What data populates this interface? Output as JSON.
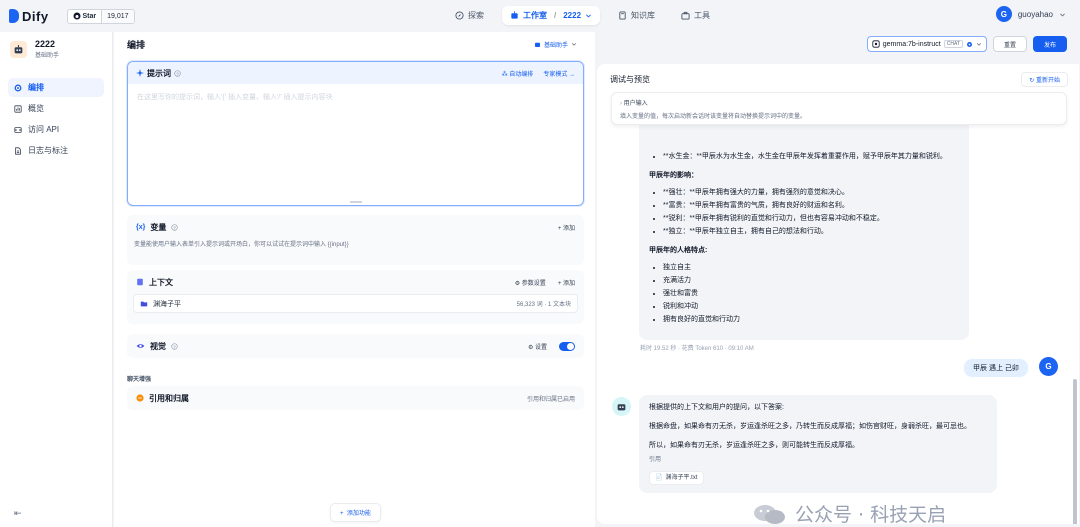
{
  "topbar": {
    "logo_text": "Dify",
    "star_label": "Star",
    "star_count": "19,017",
    "nav": [
      {
        "label": "探索",
        "icon": "compass-icon"
      },
      {
        "label": "工作室",
        "icon": "robot-icon",
        "app": "2222"
      },
      {
        "label": "知识库",
        "icon": "book-icon"
      },
      {
        "label": "工具",
        "icon": "toolbox-icon"
      }
    ],
    "avatar_letter": "G",
    "username": "guoyahao"
  },
  "sidebar": {
    "app_name": "2222",
    "app_type": "基础助手",
    "items": [
      {
        "label": "编排",
        "icon": "orchestrate-icon"
      },
      {
        "label": "概览",
        "icon": "overview-icon"
      },
      {
        "label": "访问 API",
        "icon": "api-icon"
      },
      {
        "label": "日志与标注",
        "icon": "log-icon"
      }
    ]
  },
  "editor": {
    "title": "编排",
    "mode": "基础助手",
    "prompt": {
      "title": "提示词",
      "auto_label": "自动编排",
      "expert_label": "专家模式",
      "placeholder": "在这里写你的提示词，输入'{' 插入变量、输入'/' 插入提示内容块"
    },
    "variables": {
      "title": "变量",
      "add": "添加",
      "desc": "变量能使用户输入表单引入提示词或开场白，你可以试试在提示词中输入 {{input}}"
    },
    "context": {
      "title": "上下文",
      "params": "参数设置",
      "add": "添加",
      "kb_name": "渊海子平",
      "kb_meta": "56,323 词 · 1 文本块"
    },
    "vision": {
      "title": "视觉",
      "settings": "设置",
      "enabled": true
    },
    "section_label": "聊天增强",
    "citation": {
      "title": "引用和归属",
      "status": "引用和归属已启用"
    },
    "add_feature": "添加功能"
  },
  "right": {
    "model": "gemma:7b-instruct",
    "model_badge": "CHAT",
    "reset": "重置",
    "publish": "发布",
    "debug_title": "调试与预览",
    "restart": "重新开始",
    "user_input_title": "用户输入",
    "user_input_desc": "填入变量的值，每次启动新会话时该变量将自动替换提示词中的变量。",
    "msg1": {
      "line0": "**水生金：**甲辰水为水生金，水生金在甲辰年发挥着重要作用，赋予甲辰年其力量和锐利。",
      "h1": "甲辰年的影响：",
      "list1": [
        "**强壮：**甲辰年拥有强大的力量，拥有强烈的意觉和决心。",
        "**富贵：**甲辰年拥有富贵的气质，拥有良好的财运和名利。",
        "**锐利：**甲辰年拥有锐利的直觉和行动力，但也有容易冲动和不稳定。",
        "**独立：**甲辰年独立自主，拥有自己的想法和行动。"
      ],
      "h2": "甲辰年的人格特点:",
      "list2": [
        "独立自主",
        "充满活力",
        "强壮和富贵",
        "锐利和冲动",
        "拥有良好的直觉和行动力"
      ],
      "meta": "耗时 19.52 秒 · 花费 Token 610 · 09:10 AM"
    },
    "user_msg": "甲辰 遇上 己卯",
    "user_avatar": "G",
    "msg2": {
      "p1": "根据提供的上下文和用户的提问，以下答案:",
      "p2": "根据命盘，如果命有刃无杀，岁运逢杀旺之多，乃转生而反成厚福；如伤官财旺，身弱杀旺，最可忌也。",
      "p3": "所以，如果命有刃无杀，岁运逢杀旺之多，则可能转生而反成厚福。",
      "cite_label": "引用",
      "cite_file": "渊海子平.txt"
    },
    "watermark": "公众号 · 科技天启",
    "input_count": "0"
  }
}
